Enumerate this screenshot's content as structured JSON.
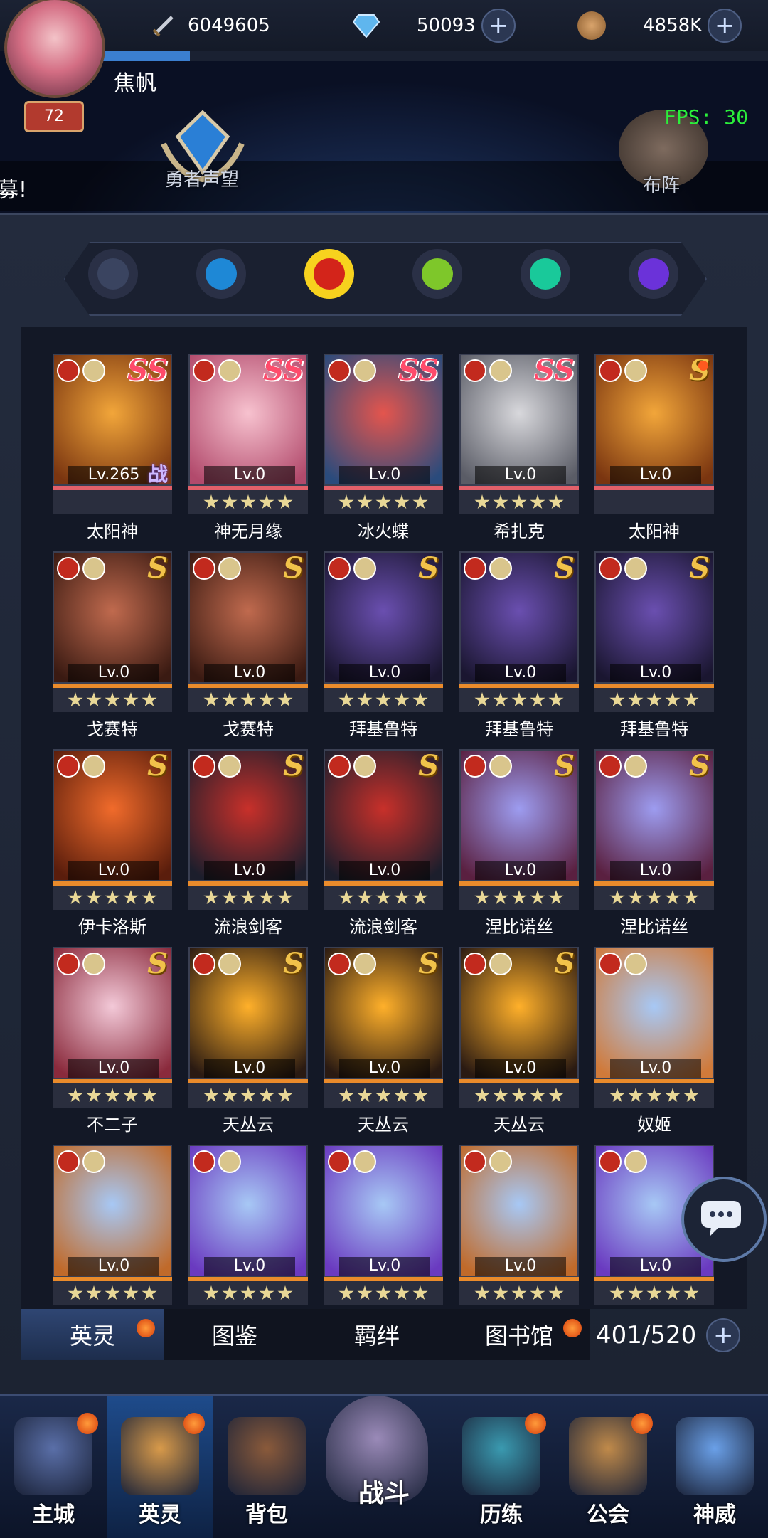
{
  "resources": {
    "power": "6049605",
    "diamonds": "50093",
    "gold": "4858K"
  },
  "player": {
    "name": "焦帆",
    "level": "72"
  },
  "fps": "FPS: 30",
  "ticker": "募!",
  "header_buttons": {
    "reputation": "勇者声望",
    "formation": "布阵"
  },
  "filters": [
    {
      "name": "all",
      "color": "#3a4460"
    },
    {
      "name": "water",
      "color": "#1e88d6"
    },
    {
      "name": "fire",
      "color": "#d3241a"
    },
    {
      "name": "wood",
      "color": "#7ec72a"
    },
    {
      "name": "wind",
      "color": "#19c99a"
    },
    {
      "name": "dark",
      "color": "#6b32d9"
    }
  ],
  "heroes": [
    {
      "name": "太阳神",
      "level": "Lv.265",
      "rank": "SS",
      "extra": "战",
      "gem": "red",
      "colors": [
        "#f2a63a",
        "#7a3510"
      ]
    },
    {
      "name": "神无月缘",
      "level": "Lv.0",
      "rank": "SS",
      "colors": [
        "#f7c2cf",
        "#b24a6c"
      ]
    },
    {
      "name": "冰火蝶",
      "level": "Lv.0",
      "rank": "SS",
      "colors": [
        "#e4554d",
        "#2a4b7c"
      ]
    },
    {
      "name": "希扎克",
      "level": "Lv.0",
      "rank": "SS",
      "colors": [
        "#d8d8dc",
        "#5a5c66"
      ]
    },
    {
      "name": "太阳神",
      "level": "Lv.0",
      "rank": "S",
      "gem": "purple",
      "dot": true,
      "colors": [
        "#f2a63a",
        "#7a3510"
      ]
    },
    {
      "name": "戈赛特",
      "level": "Lv.0",
      "rank": "S",
      "colors": [
        "#c06a4e",
        "#3a1a12"
      ]
    },
    {
      "name": "戈赛特",
      "level": "Lv.0",
      "rank": "S",
      "colors": [
        "#c06a4e",
        "#3a1a12"
      ]
    },
    {
      "name": "拜基鲁特",
      "level": "Lv.0",
      "rank": "S",
      "colors": [
        "#6a4fb0",
        "#1a1630"
      ]
    },
    {
      "name": "拜基鲁特",
      "level": "Lv.0",
      "rank": "S",
      "colors": [
        "#6a4fb0",
        "#1a1630"
      ]
    },
    {
      "name": "拜基鲁特",
      "level": "Lv.0",
      "rank": "S",
      "colors": [
        "#6a4fb0",
        "#1a1630"
      ]
    },
    {
      "name": "伊卡洛斯",
      "level": "Lv.0",
      "rank": "S",
      "colors": [
        "#f16b2b",
        "#5a1d0c"
      ]
    },
    {
      "name": "流浪剑客",
      "level": "Lv.0",
      "rank": "S",
      "colors": [
        "#c8302a",
        "#1c1e2c"
      ]
    },
    {
      "name": "流浪剑客",
      "level": "Lv.0",
      "rank": "S",
      "colors": [
        "#c8302a",
        "#1c1e2c"
      ]
    },
    {
      "name": "涅比诺丝",
      "level": "Lv.0",
      "rank": "S",
      "colors": [
        "#9d9cf0",
        "#5a2040"
      ]
    },
    {
      "name": "涅比诺丝",
      "level": "Lv.0",
      "rank": "S",
      "colors": [
        "#9d9cf0",
        "#5a2040"
      ]
    },
    {
      "name": "不二子",
      "level": "Lv.0",
      "rank": "S",
      "colors": [
        "#f3c9d8",
        "#8a2a3c"
      ]
    },
    {
      "name": "天丛云",
      "level": "Lv.0",
      "rank": "S",
      "colors": [
        "#ffb02a",
        "#2a1a12"
      ]
    },
    {
      "name": "天丛云",
      "level": "Lv.0",
      "rank": "S",
      "colors": [
        "#ffb02a",
        "#2a1a12"
      ]
    },
    {
      "name": "天丛云",
      "level": "Lv.0",
      "rank": "S",
      "colors": [
        "#ffb02a",
        "#2a1a12"
      ]
    },
    {
      "name": "奴姬",
      "level": "Lv.0",
      "rank": "",
      "colors": [
        "#a7c8f5",
        "#d07a3a"
      ]
    },
    {
      "name": "",
      "level": "Lv.0",
      "rank": "",
      "colors": [
        "#a7c8f5",
        "#c06a2a"
      ]
    },
    {
      "name": "",
      "level": "Lv.0",
      "rank": "",
      "colors": [
        "#a7c8f5",
        "#6a3ac0"
      ]
    },
    {
      "name": "",
      "level": "Lv.0",
      "rank": "",
      "colors": [
        "#a7c8f5",
        "#6a3ac0"
      ]
    },
    {
      "name": "",
      "level": "Lv.0",
      "rank": "",
      "colors": [
        "#a7c8f5",
        "#c06a2a"
      ]
    },
    {
      "name": "",
      "level": "Lv.0",
      "rank": "",
      "colors": [
        "#a7c8f5",
        "#6a3ac0"
      ]
    }
  ],
  "tabs": [
    {
      "label": "英灵",
      "dot": true
    },
    {
      "label": "图鉴",
      "dot": false
    },
    {
      "label": "羁绊",
      "dot": false
    },
    {
      "label": "图书馆",
      "dot": true
    }
  ],
  "hero_count": "401/520",
  "nav": [
    {
      "label": "主城",
      "dot": true,
      "color": "#5a6fa8"
    },
    {
      "label": "英灵",
      "dot": true,
      "color": "#d89a4a"
    },
    {
      "label": "背包",
      "dot": false,
      "color": "#8a5a3a"
    },
    {
      "label": "战斗",
      "dot": false,
      "color": "#9a8ab8"
    },
    {
      "label": "历练",
      "dot": true,
      "color": "#3a9ab0"
    },
    {
      "label": "公会",
      "dot": true,
      "color": "#c08a4a"
    },
    {
      "label": "神威",
      "dot": false,
      "color": "#6aa0e8"
    }
  ]
}
